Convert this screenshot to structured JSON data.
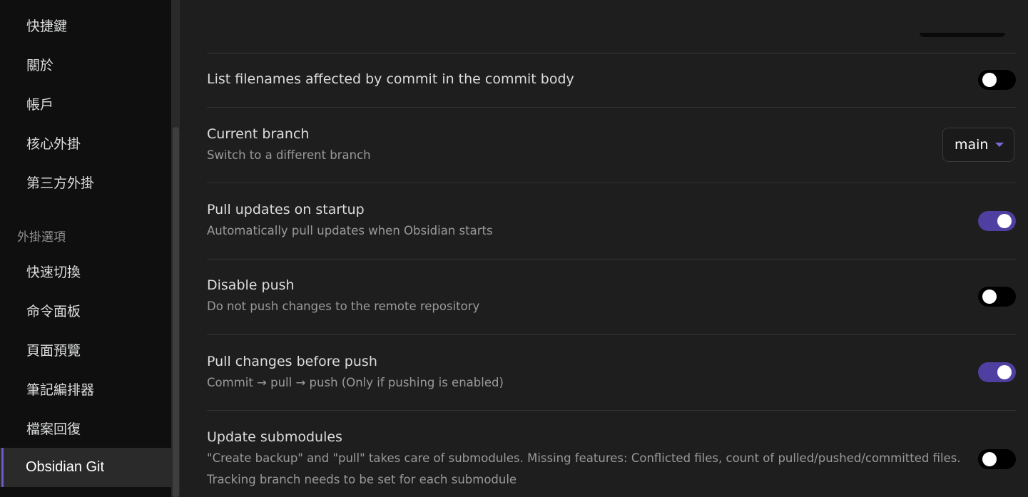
{
  "sidebar": {
    "top_items": [
      "快捷鍵",
      "關於",
      "帳戶",
      "核心外掛",
      "第三方外掛"
    ],
    "section_heading": "外掛選項",
    "plugin_items": [
      "快速切換",
      "命令面板",
      "頁面預覽",
      "筆記編排器",
      "檔案回復"
    ],
    "active_item": "Obsidian Git"
  },
  "settings": [
    {
      "name": "List filenames affected by commit in the commit body",
      "desc": "",
      "control": "toggle",
      "state": "off"
    },
    {
      "name": "Current branch",
      "desc": "Switch to a different branch",
      "control": "dropdown",
      "value": "main"
    },
    {
      "name": "Pull updates on startup",
      "desc": "Automatically pull updates when Obsidian starts",
      "control": "toggle",
      "state": "on"
    },
    {
      "name": "Disable push",
      "desc": "Do not push changes to the remote repository",
      "control": "toggle",
      "state": "off"
    },
    {
      "name": "Pull changes before push",
      "desc": "Commit → pull → push (Only if pushing is enabled)",
      "control": "toggle",
      "state": "on"
    },
    {
      "name": "Update submodules",
      "desc": "\"Create backup\" and \"pull\" takes care of submodules. Missing features: Conflicted files, count of pulled/pushed/committed files. Tracking branch needs to be set for each submodule",
      "control": "toggle",
      "state": "off"
    }
  ],
  "colors": {
    "accent": "#4f3fa0",
    "sidebar_bg": "#0f0f0f",
    "content_bg": "#1e1e1e"
  }
}
